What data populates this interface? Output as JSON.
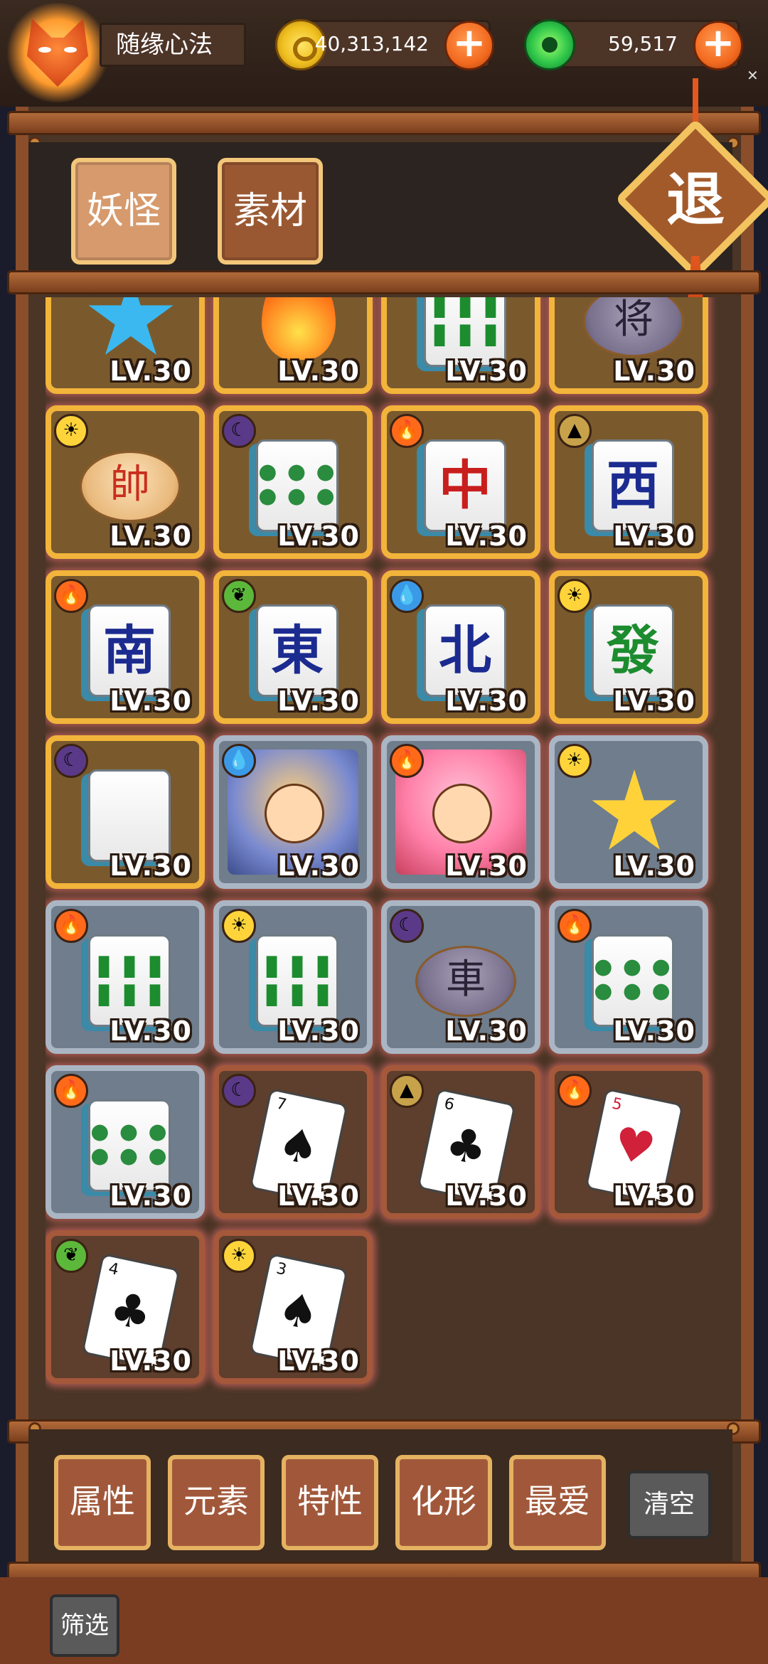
{
  "header": {
    "player_name": "随缘心法",
    "gold": "40,313,142",
    "jade": "59,517",
    "plus_label": "+"
  },
  "tabs": [
    {
      "label": "妖怪",
      "active": true
    },
    {
      "label": "素材",
      "active": false
    }
  ],
  "exit_label": "退",
  "level_prefix": "LV.",
  "cards": [
    {
      "frame": "gold",
      "element": null,
      "art": "star-blue",
      "level": 30
    },
    {
      "frame": "gold",
      "element": null,
      "art": "flame",
      "level": 30
    },
    {
      "frame": "gold",
      "element": null,
      "art": "tile-bamboo",
      "level": 30
    },
    {
      "frame": "gold",
      "element": null,
      "art": "piece-dark",
      "glyph": "将",
      "level": 30
    },
    {
      "frame": "gold",
      "element": "sun",
      "art": "piece",
      "glyph": "帥",
      "level": 30
    },
    {
      "frame": "gold",
      "element": "moon",
      "art": "tile-dots",
      "level": 30
    },
    {
      "frame": "gold",
      "element": "fire",
      "art": "tile",
      "glyph": "中",
      "color": "red",
      "level": 30
    },
    {
      "frame": "gold",
      "element": "earth",
      "art": "tile",
      "glyph": "西",
      "level": 30
    },
    {
      "frame": "gold",
      "element": "fire",
      "art": "tile",
      "glyph": "南",
      "level": 30
    },
    {
      "frame": "gold",
      "element": "leaf",
      "art": "tile",
      "glyph": "東",
      "level": 30
    },
    {
      "frame": "gold",
      "element": "water",
      "art": "tile",
      "glyph": "北",
      "level": 30
    },
    {
      "frame": "gold",
      "element": "sun",
      "art": "tile",
      "glyph": "發",
      "color": "green",
      "level": 30
    },
    {
      "frame": "gold",
      "element": "moon",
      "art": "tile-blank",
      "level": 30
    },
    {
      "frame": "silver",
      "element": "water",
      "art": "hero-1",
      "level": 30
    },
    {
      "frame": "silver",
      "element": "fire",
      "art": "hero-2",
      "level": 30
    },
    {
      "frame": "silver",
      "element": "sun",
      "art": "star-gold",
      "level": 30
    },
    {
      "frame": "silver",
      "element": "fire",
      "art": "tile-bamboo",
      "level": 30
    },
    {
      "frame": "silver",
      "element": "sun",
      "art": "tile-bamboo",
      "level": 30
    },
    {
      "frame": "silver",
      "element": "moon",
      "art": "piece-dark",
      "glyph": "車",
      "level": 30
    },
    {
      "frame": "silver",
      "element": "fire",
      "art": "tile-dots",
      "level": 30
    },
    {
      "frame": "silver",
      "element": "fire",
      "art": "tile-dots",
      "level": 30
    },
    {
      "frame": "bronze",
      "element": "moon",
      "art": "card",
      "rank": "7",
      "suit": "♠",
      "level": 30
    },
    {
      "frame": "bronze",
      "element": "earth",
      "art": "card",
      "rank": "6",
      "suit": "♣",
      "level": 30
    },
    {
      "frame": "bronze",
      "element": "fire",
      "art": "card",
      "rank": "5",
      "suit": "♥",
      "color": "red",
      "level": 30
    },
    {
      "frame": "bronze",
      "element": "leaf",
      "art": "card",
      "rank": "4",
      "suit": "♣",
      "level": 30
    },
    {
      "frame": "bronze",
      "element": "sun",
      "art": "card",
      "rank": "3",
      "suit": "♠",
      "level": 30
    }
  ],
  "filters": [
    "属性",
    "元素",
    "特性",
    "化形",
    "最爱"
  ],
  "clear_label": "清空",
  "screen_label": "筛选",
  "colors": {
    "frame_wood": "#8a4e2a",
    "gold_frame": "#f2b43a",
    "silver_frame": "#aab6c4",
    "bronze_frame": "#a5583a",
    "accent_orange": "#f26a1f"
  }
}
